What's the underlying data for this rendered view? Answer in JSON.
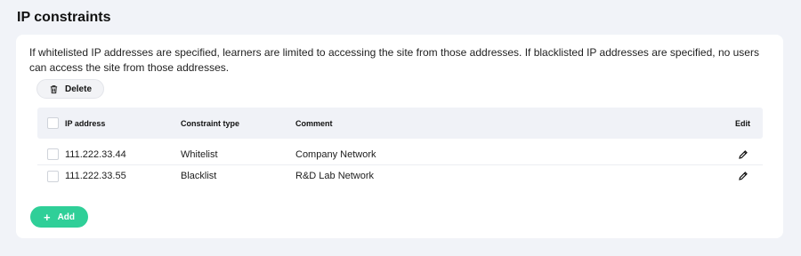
{
  "section": {
    "title": "IP constraints",
    "description": "If whitelisted IP addresses are specified, learners are limited to accessing the site from those addresses. If blacklisted IP addresses are specified, no users can access the site from those addresses."
  },
  "toolbar": {
    "delete_label": "Delete",
    "delete_icon": "trash-icon",
    "add_label": "Add",
    "add_icon": "plus-icon"
  },
  "table": {
    "columns": {
      "ip": "IP address",
      "type": "Constraint type",
      "comment": "Comment",
      "edit": "Edit"
    },
    "rows": [
      {
        "ip": "111.222.33.44",
        "type": "Whitelist",
        "comment": "Company Network",
        "checked": false
      },
      {
        "ip": "111.222.33.55",
        "type": "Blacklist",
        "comment": "R&D Lab Network",
        "checked": false
      }
    ]
  },
  "colors": {
    "page_background": "#f1f3f8",
    "card_background": "#ffffff",
    "header_background": "#f0f2f7",
    "accent": "#2fcf98"
  }
}
